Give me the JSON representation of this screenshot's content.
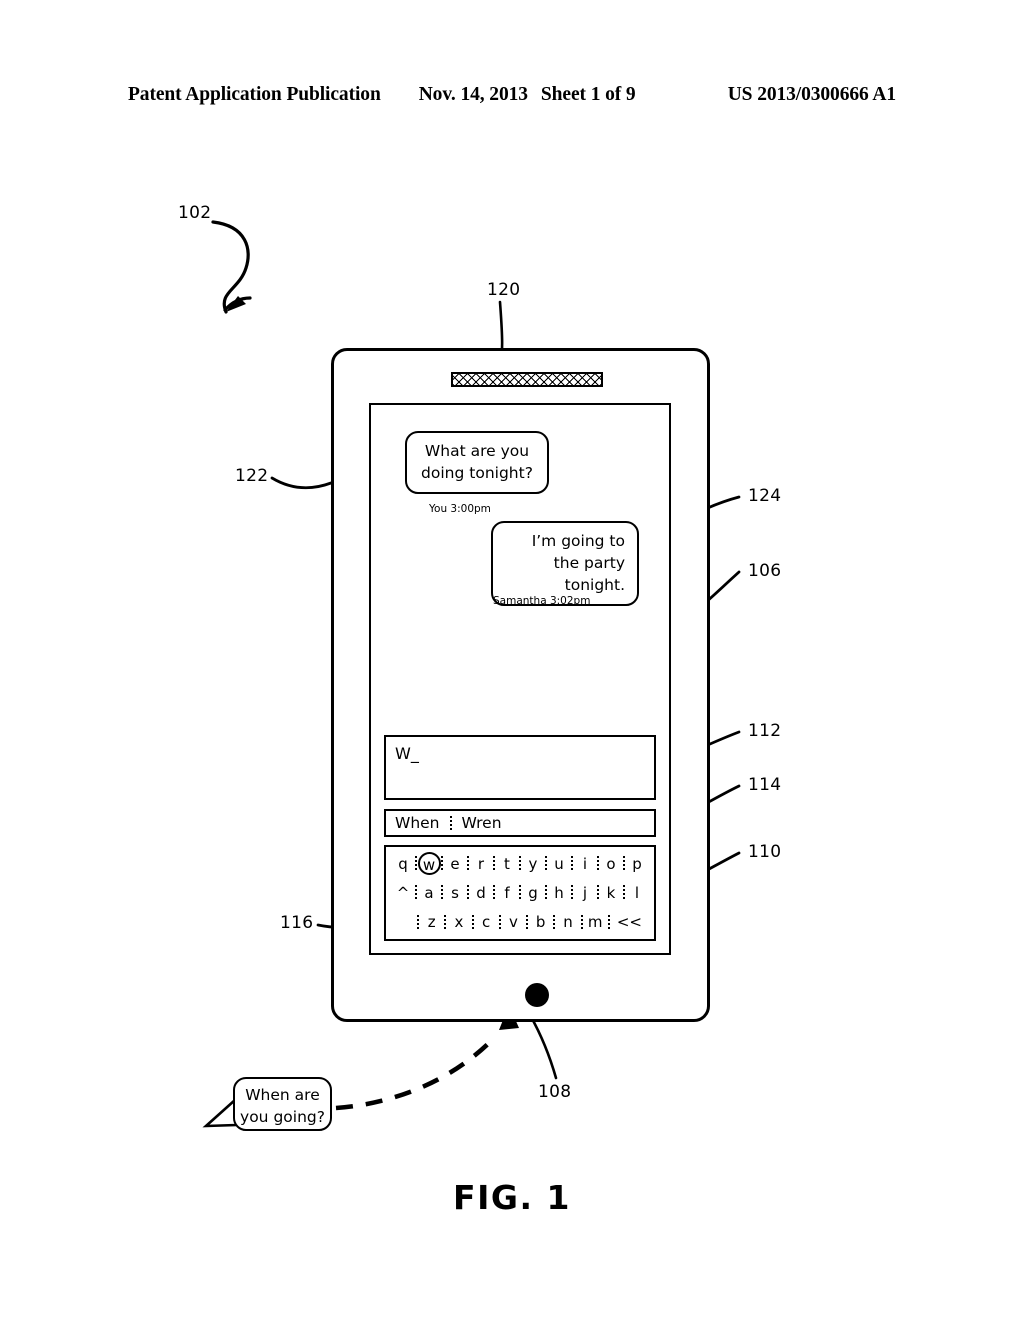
{
  "header": {
    "publication": "Patent Application Publication",
    "date": "Nov. 14, 2013",
    "sheet": "Sheet 1 of 9",
    "number": "US 2013/0300666 A1"
  },
  "figure": {
    "caption": "FIG. 1"
  },
  "reference_numerals": {
    "device": "102",
    "speaker": "120",
    "display": "122",
    "incoming_bubble": "124",
    "screen": "106",
    "text_input": "112",
    "suggestion_bar": "114",
    "keyboard": "110",
    "mic_key": "116",
    "mic_button": "108"
  },
  "conversation": {
    "messages": [
      {
        "text": "What are you doing tonight?",
        "sender": "You",
        "time": "3:00pm",
        "meta": "You 3:00pm",
        "align": "left"
      },
      {
        "text": "I’m going to the party tonight.",
        "sender": "Samantha",
        "time": "3:02pm",
        "meta": "Samantha 3:02pm",
        "align": "right"
      }
    ]
  },
  "text_input": {
    "value": "W",
    "caret": "_"
  },
  "suggestions": {
    "first": "When",
    "second": "Wren",
    "separator": "|"
  },
  "keyboard": {
    "row1": [
      "q",
      "w",
      "e",
      "r",
      "t",
      "y",
      "u",
      "i",
      "o",
      "p"
    ],
    "row2": [
      "^",
      "a",
      "s",
      "d",
      "f",
      "g",
      "h",
      "j",
      "k",
      "l"
    ],
    "row3": [
      "z",
      "x",
      "c",
      "v",
      "b",
      "n",
      "m",
      "<<"
    ],
    "highlighted_key": "w",
    "mic_key_icon": "microphone-icon"
  },
  "navbar": {
    "back_icon": "back-arrow-icon",
    "menu_icon": "menu-icon",
    "mic_icon": "microphone-button-icon",
    "home_icon": "home-icon",
    "search_icon": "search-icon"
  },
  "voice_bubble": {
    "text": "When are you going?",
    "line1": "When are",
    "line2": "you going?"
  },
  "colors": {
    "ink": "#000000",
    "paper": "#ffffff"
  }
}
